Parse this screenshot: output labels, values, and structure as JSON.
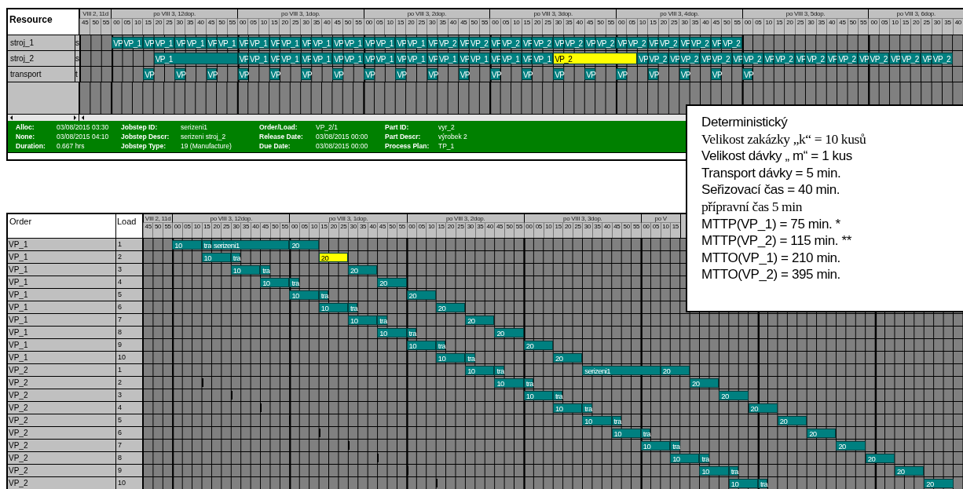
{
  "resource_chart": {
    "columns": [
      "Resource"
    ],
    "header": {
      "hours": [
        {
          "label": "VIII 2, 11d",
          "minutes": [
            "45",
            "50",
            "55"
          ]
        },
        {
          "label": "po VIII 3, 12dop.",
          "minutes": [
            "00",
            "05",
            "10",
            "15",
            "20",
            "25",
            "30",
            "35",
            "40",
            "45",
            "50",
            "55"
          ]
        },
        {
          "label": "po VIII 3, 1dop.",
          "minutes": [
            "00",
            "05",
            "10",
            "15",
            "20",
            "25",
            "30",
            "35",
            "40",
            "45",
            "50",
            "55"
          ]
        },
        {
          "label": "po VIII 3, 2dop.",
          "minutes": [
            "00",
            "05",
            "10",
            "15",
            "20",
            "25",
            "30",
            "35",
            "40",
            "45",
            "50",
            "55"
          ]
        },
        {
          "label": "po VIII 3, 3dop.",
          "minutes": [
            "00",
            "05",
            "10",
            "15",
            "20",
            "25",
            "30",
            "35",
            "40",
            "45",
            "50",
            "55"
          ]
        },
        {
          "label": "po VIII 3, 4dop.",
          "minutes": [
            "00",
            "05",
            "10",
            "15",
            "20",
            "25",
            "30",
            "35",
            "40",
            "45",
            "50",
            "55"
          ]
        },
        {
          "label": "po VIII 3, 5dop.",
          "minutes": [
            "00",
            "05",
            "10",
            "15",
            "20",
            "25",
            "30",
            "35",
            "40",
            "45",
            "50",
            "55"
          ]
        },
        {
          "label": "po VIII 3, 6dop.",
          "minutes": [
            "00",
            "05",
            "10",
            "15",
            "20",
            "25",
            "30",
            "35",
            "40"
          ]
        }
      ]
    },
    "rows": [
      {
        "name": "stroj_1",
        "column_2": "s",
        "bars": [
          {
            "label": "VP",
            "selected": false
          },
          {
            "label": "VP_1",
            "selected": false
          },
          {
            "label": "VP",
            "selected": false
          },
          {
            "label": "VP_1",
            "selected": false
          },
          {
            "label": "VP",
            "selected": false
          },
          {
            "label": "VP_1",
            "selected": false
          },
          {
            "label": "VP",
            "selected": false
          },
          {
            "label": "VP_1",
            "selected": false
          },
          {
            "label": "VP",
            "selected": false
          },
          {
            "label": "VP_1",
            "selected": false
          },
          {
            "label": "VP",
            "selected": false
          },
          {
            "label": "VP_1",
            "selected": false
          },
          {
            "label": "VP",
            "selected": false
          },
          {
            "label": "VP_1",
            "selected": false
          },
          {
            "label": "VP",
            "selected": false
          },
          {
            "label": "VP_1",
            "selected": false
          },
          {
            "label": "VP",
            "selected": false
          },
          {
            "label": "VP_1",
            "selected": false
          },
          {
            "label": "VP",
            "selected": false
          },
          {
            "label": "VP_1",
            "selected": false
          },
          {
            "label": "VP",
            "selected": false
          },
          {
            "label": "VP_2",
            "selected": false
          },
          {
            "label": "VP",
            "selected": false
          },
          {
            "label": "VP_2",
            "selected": false
          },
          {
            "label": "VP",
            "selected": false
          },
          {
            "label": "VP_2",
            "selected": false
          },
          {
            "label": "VP",
            "selected": false
          },
          {
            "label": "VP_2",
            "selected": false
          },
          {
            "label": "VP",
            "selected": false
          },
          {
            "label": "VP_2",
            "selected": false
          },
          {
            "label": "VP",
            "selected": false
          },
          {
            "label": "VP_2",
            "selected": false
          },
          {
            "label": "VP",
            "selected": false
          },
          {
            "label": "VP_2",
            "selected": false
          },
          {
            "label": "VP",
            "selected": false
          },
          {
            "label": "VP_2",
            "selected": false
          },
          {
            "label": "VP",
            "selected": false
          },
          {
            "label": "VP_2",
            "selected": false
          },
          {
            "label": "VP",
            "selected": false
          },
          {
            "label": "VP_2",
            "selected": false
          }
        ]
      },
      {
        "name": "stroj_2",
        "column_2": "s",
        "bars": [
          {
            "label": "VP_1",
            "selected": false
          },
          {
            "label": "VP",
            "selected": false
          },
          {
            "label": "VP_1",
            "selected": false
          },
          {
            "label": "VP",
            "selected": false
          },
          {
            "label": "VP_1",
            "selected": false
          },
          {
            "label": "VP",
            "selected": false
          },
          {
            "label": "VP_1",
            "selected": false
          },
          {
            "label": "VP",
            "selected": false
          },
          {
            "label": "VP_1",
            "selected": false
          },
          {
            "label": "VP",
            "selected": false
          },
          {
            "label": "VP_1",
            "selected": false
          },
          {
            "label": "VP",
            "selected": false
          },
          {
            "label": "VP_1",
            "selected": false
          },
          {
            "label": "VP",
            "selected": false
          },
          {
            "label": "VP_1",
            "selected": false
          },
          {
            "label": "VP",
            "selected": false
          },
          {
            "label": "VP_1",
            "selected": false
          },
          {
            "label": "VP",
            "selected": false
          },
          {
            "label": "VP_1",
            "selected": false
          },
          {
            "label": "VP",
            "selected": false
          },
          {
            "label": "VP_1",
            "selected": false
          },
          {
            "label": "VP_2",
            "selected": true
          },
          {
            "label": "VP",
            "selected": false
          },
          {
            "label": "VP_2",
            "selected": false
          },
          {
            "label": "VP",
            "selected": false
          },
          {
            "label": "VP_2",
            "selected": false
          },
          {
            "label": "VP",
            "selected": false
          },
          {
            "label": "VP_2",
            "selected": false
          },
          {
            "label": "VP",
            "selected": false
          },
          {
            "label": "VP_2",
            "selected": false
          },
          {
            "label": "VP",
            "selected": false
          },
          {
            "label": "VP_2",
            "selected": false
          },
          {
            "label": "VP",
            "selected": false
          },
          {
            "label": "VP_2",
            "selected": false
          },
          {
            "label": "VP",
            "selected": false
          },
          {
            "label": "VP_2",
            "selected": false
          },
          {
            "label": "VP",
            "selected": false
          },
          {
            "label": "VP_2",
            "selected": false
          },
          {
            "label": "VP",
            "selected": false
          },
          {
            "label": "VP_2",
            "selected": false
          },
          {
            "label": "VP",
            "selected": false
          },
          {
            "label": "VP_2",
            "selected": false
          }
        ]
      },
      {
        "name": "transport",
        "column_2": "t",
        "bars": [
          {
            "label": "VP",
            "selected": false
          },
          {
            "label": "VP",
            "selected": false
          },
          {
            "label": "VP",
            "selected": false
          },
          {
            "label": "VP",
            "selected": false
          },
          {
            "label": "VP",
            "selected": false
          },
          {
            "label": "VP",
            "selected": false
          },
          {
            "label": "VP",
            "selected": false
          },
          {
            "label": "VP",
            "selected": false
          },
          {
            "label": "VP",
            "selected": false
          },
          {
            "label": "VP",
            "selected": false
          },
          {
            "label": "VP",
            "selected": false
          },
          {
            "label": "VP",
            "selected": false
          },
          {
            "label": "VP",
            "selected": false
          },
          {
            "label": "VP",
            "selected": false
          },
          {
            "label": "VP",
            "selected": false
          },
          {
            "label": "VP",
            "selected": false
          },
          {
            "label": "VP",
            "selected": false
          },
          {
            "label": "VP",
            "selected": false
          },
          {
            "label": "VP",
            "selected": false
          },
          {
            "label": "VP",
            "selected": false
          }
        ]
      }
    ]
  },
  "details": [
    {
      "label": "Alloc:",
      "value": "03/08/2015 03:30"
    },
    {
      "label": "Jobstep ID:",
      "value": "serizeni1"
    },
    {
      "label": "Order/Load:",
      "value": "VP_2/1"
    },
    {
      "label": "Part ID:",
      "value": "vyr_2"
    },
    {
      "label": "None:",
      "value": "03/08/2015 04:10"
    },
    {
      "label": "Jobstep Descr:",
      "value": "serizeni stroj_2"
    },
    {
      "label": "Release Date:",
      "value": "03/08/2015 00:00"
    },
    {
      "label": "Part Descr:",
      "value": "výrobek 2"
    },
    {
      "label": "Duration:",
      "value": "0.667 hrs"
    },
    {
      "label": "Jobstep Type:",
      "value": "19 (Manufacture)"
    },
    {
      "label": "Due Date:",
      "value": "03/08/2015 00:00"
    },
    {
      "label": "Process Plan:",
      "value": "TP_1"
    }
  ],
  "order_chart": {
    "columns": [
      "Order",
      "Load"
    ],
    "header": {
      "hours": [
        {
          "label": "VIII 2, 11d",
          "minutes": [
            "45",
            "50",
            "55"
          ]
        },
        {
          "label": "po VIII 3, 12dop.",
          "minutes": [
            "00",
            "05",
            "10",
            "15",
            "20",
            "25",
            "30",
            "35",
            "40",
            "45",
            "50",
            "55"
          ]
        },
        {
          "label": "po VIII 3, 1dop.",
          "minutes": [
            "00",
            "05",
            "10",
            "15",
            "20",
            "25",
            "30",
            "35",
            "40",
            "45",
            "50",
            "55"
          ]
        },
        {
          "label": "po VIII 3, 2dop.",
          "minutes": [
            "00",
            "05",
            "10",
            "15",
            "20",
            "25",
            "30",
            "35",
            "40",
            "45",
            "50",
            "55"
          ]
        },
        {
          "label": "po VIII 3, 3dop.",
          "minutes": [
            "00",
            "05",
            "10",
            "15",
            "20",
            "25",
            "30",
            "35",
            "40",
            "45",
            "50",
            "55"
          ]
        },
        {
          "label": "po V",
          "minutes": [
            "00",
            "05",
            "10",
            "15"
          ]
        }
      ]
    },
    "rows": [
      {
        "order": "VP_1",
        "load": "1",
        "bars": [
          {
            "label": "10",
            "selected": false
          },
          {
            "label": "tra",
            "selected": false
          },
          {
            "label": "serizeni1",
            "selected": false
          },
          {
            "label": "20",
            "selected": false
          }
        ]
      },
      {
        "order": "VP_1",
        "load": "2",
        "bars": [
          {
            "label": "10",
            "selected": false
          },
          {
            "label": "tra",
            "selected": false
          },
          {
            "label": "20",
            "selected": true
          }
        ]
      },
      {
        "order": "VP_1",
        "load": "3",
        "bars": [
          {
            "label": "10",
            "selected": false
          },
          {
            "label": "tra",
            "selected": false
          },
          {
            "label": "20",
            "selected": false
          }
        ]
      },
      {
        "order": "VP_1",
        "load": "4",
        "bars": [
          {
            "label": "10",
            "selected": false
          },
          {
            "label": "tra",
            "selected": false
          },
          {
            "label": "20",
            "selected": false
          }
        ]
      },
      {
        "order": "VP_1",
        "load": "5",
        "bars": [
          {
            "label": "10",
            "selected": false
          },
          {
            "label": "tra",
            "selected": false
          },
          {
            "label": "20",
            "selected": false
          }
        ]
      },
      {
        "order": "VP_1",
        "load": "6",
        "bars": [
          {
            "label": "10",
            "selected": false
          },
          {
            "label": "tra",
            "selected": false
          },
          {
            "label": "20",
            "selected": false
          }
        ]
      },
      {
        "order": "VP_1",
        "load": "7",
        "bars": [
          {
            "label": "10",
            "selected": false
          },
          {
            "label": "tra",
            "selected": false
          },
          {
            "label": "20",
            "selected": false
          }
        ]
      },
      {
        "order": "VP_1",
        "load": "8",
        "bars": [
          {
            "label": "10",
            "selected": false
          },
          {
            "label": "tra",
            "selected": false
          },
          {
            "label": "20",
            "selected": false
          }
        ]
      },
      {
        "order": "VP_1",
        "load": "9",
        "bars": [
          {
            "label": "10",
            "selected": false
          },
          {
            "label": "tra",
            "selected": false
          },
          {
            "label": "20",
            "selected": false
          }
        ]
      },
      {
        "order": "VP_1",
        "load": "10",
        "bars": [
          {
            "label": "10",
            "selected": false
          },
          {
            "label": "tra",
            "selected": false
          },
          {
            "label": "20",
            "selected": false
          }
        ]
      },
      {
        "order": "VP_2",
        "load": "1",
        "bars": [
          {
            "label": "10",
            "selected": false
          },
          {
            "label": "tra",
            "selected": false
          },
          {
            "label": "serizeni1",
            "selected": false
          },
          {
            "label": "20",
            "selected": false
          }
        ]
      },
      {
        "order": "VP_2",
        "load": "2",
        "bars": [
          {
            "label": "10",
            "selected": false
          },
          {
            "label": "tra",
            "selected": false
          },
          {
            "label": "20",
            "selected": false
          }
        ]
      },
      {
        "order": "VP_2",
        "load": "3",
        "bars": [
          {
            "label": "10",
            "selected": false
          },
          {
            "label": "tra",
            "selected": false
          },
          {
            "label": "20",
            "selected": false
          }
        ]
      },
      {
        "order": "VP_2",
        "load": "4",
        "bars": [
          {
            "label": "10",
            "selected": false
          },
          {
            "label": "tra",
            "selected": false
          },
          {
            "label": "20",
            "selected": false
          }
        ]
      },
      {
        "order": "VP_2",
        "load": "5",
        "bars": [
          {
            "label": "10",
            "selected": false
          },
          {
            "label": "tra",
            "selected": false
          },
          {
            "label": "20",
            "selected": false
          }
        ]
      },
      {
        "order": "VP_2",
        "load": "6",
        "bars": [
          {
            "label": "10",
            "selected": false
          },
          {
            "label": "tra",
            "selected": false
          },
          {
            "label": "20",
            "selected": false
          }
        ]
      },
      {
        "order": "VP_2",
        "load": "7",
        "bars": [
          {
            "label": "10",
            "selected": false
          },
          {
            "label": "tra",
            "selected": false
          },
          {
            "label": "20",
            "selected": false
          }
        ]
      },
      {
        "order": "VP_2",
        "load": "8",
        "bars": [
          {
            "label": "10",
            "selected": false
          },
          {
            "label": "tra",
            "selected": false
          },
          {
            "label": "20",
            "selected": false
          }
        ]
      },
      {
        "order": "VP_2",
        "load": "9",
        "bars": [
          {
            "label": "10",
            "selected": false
          },
          {
            "label": "tra",
            "selected": false
          },
          {
            "label": "20",
            "selected": false
          }
        ]
      },
      {
        "order": "VP_2",
        "load": "10",
        "bars": [
          {
            "label": "10",
            "selected": false
          },
          {
            "label": "tra",
            "selected": false
          },
          {
            "label": "20",
            "selected": false
          }
        ]
      }
    ]
  },
  "note": {
    "lines": [
      "Deterministický",
      "Velikost zakázky „k“ = 10 kusů",
      "Velikost dávky „ m“ = 1 kus",
      "Transport dávky = 5 min.",
      "Seřizovací čas = 40 min.",
      "přípravní čas 5 min",
      "MTTP(VP_1) = 75 min. *",
      "MTTP(VP_2) = 115 min. **",
      "MTTO(VP_1) = 210 min.",
      "MTTO(VP_2) = 395 min."
    ]
  }
}
